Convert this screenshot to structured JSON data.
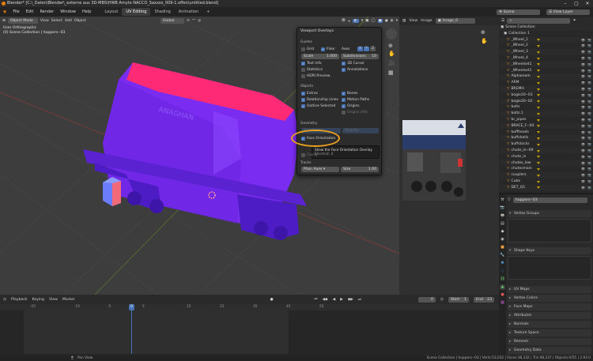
{
  "title_bar": {
    "text": "Blender* [C:\\_Daten\\Blender\\_externe aus 3D-MBS\\HWB Amyto NACCO_Saxxos_009-1.offen\\untitled.blend]"
  },
  "menu": [
    "File",
    "Edit",
    "Render",
    "Window",
    "Help"
  ],
  "workspaces": [
    "Layout",
    "UV Editing",
    "Shading",
    "Animation"
  ],
  "active_workspace": "UV Editing",
  "add_workspace": "+",
  "scene": {
    "label": "Scene",
    "view_layer": "View Layer"
  },
  "viewport": {
    "mode": "Object Mode",
    "menus": [
      "View",
      "Select",
      "Add",
      "Object"
    ],
    "orientation": "Global",
    "overlay_line1": "User Orthographic",
    "overlay_line2": "(0) Scene Collection | hoppers--03"
  },
  "overlays_popup": {
    "title": "Viewport Overlays",
    "guides_label": "Guides",
    "grid": "Grid",
    "floor": "Floor",
    "axes": "Axes",
    "axes_x": "X",
    "axes_y": "Y",
    "axes_z": "Z",
    "scale_label": "Scale",
    "scale_value": "1.000",
    "subdivisions_label": "Subdivisions",
    "subdivisions_value": "10",
    "text_info": "Text Info",
    "cursor_3d": "3D Cursor",
    "statistics": "Statistics",
    "annotations": "Annotations",
    "hdri_preview": "HDRI Preview",
    "objects_label": "Objects",
    "extras": "Extras",
    "bones": "Bones",
    "relationship_lines": "Relationship Lines",
    "motion_paths": "Motion Paths",
    "outline_selected": "Outline Selected",
    "origins": "Origins",
    "origins_all": "Origins (All)",
    "geometry_label": "Geometry",
    "wireframe": "Wireframe",
    "opacity": "Opacity",
    "fade_geometry": "Fade Geometry",
    "face_orientation": "Face Orientation",
    "tooltip_text": "Show the Face Orientation Overlay",
    "tooltip_shortcut": "Shortcut: 4",
    "cavity_label": "Cavity",
    "tracks_label": "Tracks",
    "plain_axes": "Plain Axes",
    "size_label": "Size",
    "size_value": "1.00"
  },
  "image_editor": {
    "menus": [
      "View",
      "Image"
    ],
    "image_name": "Image_0"
  },
  "outliner": {
    "search_placeholder": "",
    "items": [
      "Scene Collection",
      "Collection 1",
      "_Wheel_1",
      "_Wheel_2",
      "_Wheel_3",
      "_Wheel_4",
      "_Wheelset1",
      "_Wheelset1",
      "Alphamam",
      "ARM",
      "BREMH",
      "bogie20--03",
      "bogie20--02",
      "bolts",
      "bolts.1",
      "br_pipes",
      "BRACE_F--04",
      "buffheads",
      "buffshells",
      "buffstocks",
      "chute_in--09",
      "chute_in",
      "chutes_low",
      "chutesmain",
      "couplers",
      "Cube",
      "DET_Q1"
    ]
  },
  "properties": {
    "object_name": "hoppers--03",
    "panels": [
      "Vertex Groups",
      "Shape Keys",
      "UV Maps",
      "Vertex Colors",
      "Face Maps",
      "Attributes",
      "Normals",
      "Texture Space",
      "Remesh",
      "Geometry Data"
    ]
  },
  "timeline": {
    "menus": [
      "Playback",
      "Keying",
      "View",
      "Marker"
    ],
    "current_frame": "0",
    "start_label": "Start",
    "start_value": "1",
    "end_label": "End",
    "end_value": "23",
    "ruler": [
      "-25",
      "-15",
      "-5",
      "0",
      "5",
      "15",
      "25",
      "35",
      "45",
      "55"
    ]
  },
  "status_bar": {
    "left": "Pan View",
    "right": "Scene Collection | hoppers--03 | Verts:53,032 | Faces:38,332 | Tris:98,337 | Objects:0/55 | 2.93.0"
  },
  "colors": {
    "accent_blue": "#4772b3",
    "highlight_orange": "#e8a020",
    "face_back_red": "#ff2a55",
    "face_front_blue": "#5a2dff"
  }
}
